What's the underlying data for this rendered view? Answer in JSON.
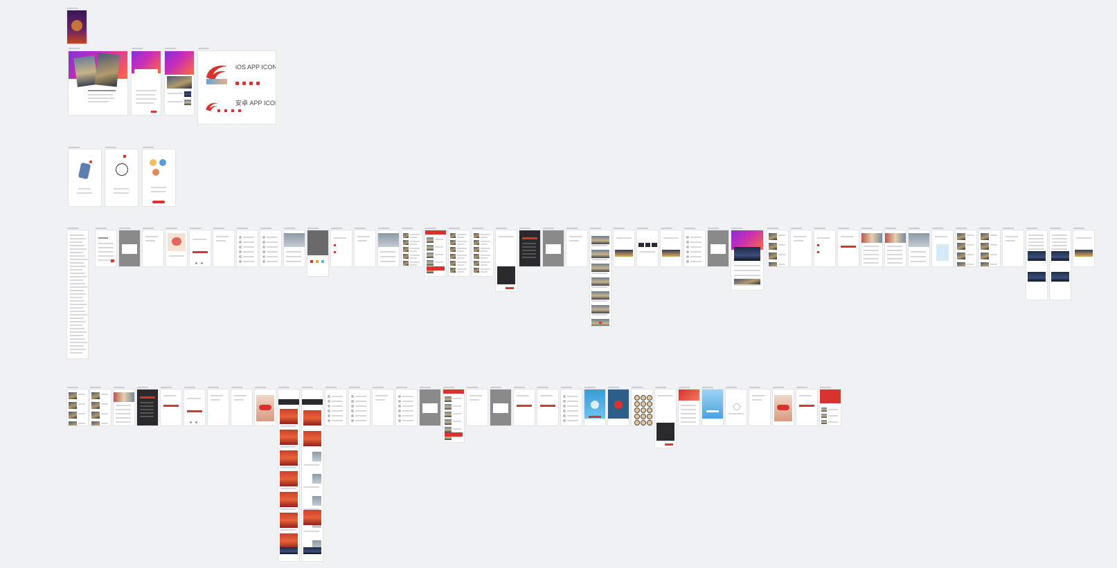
{
  "app": {
    "background": "#eff1f5",
    "accent": "#d8332f",
    "brand_gradient": [
      "#8a2cd6",
      "#c92fb5",
      "#ff6a3d"
    ]
  },
  "icon_board": {
    "ios_label": "iOS APP ICON",
    "android_label": "安卓 APP ICON",
    "icon_name": "red-swirl-logo-icon"
  }
}
